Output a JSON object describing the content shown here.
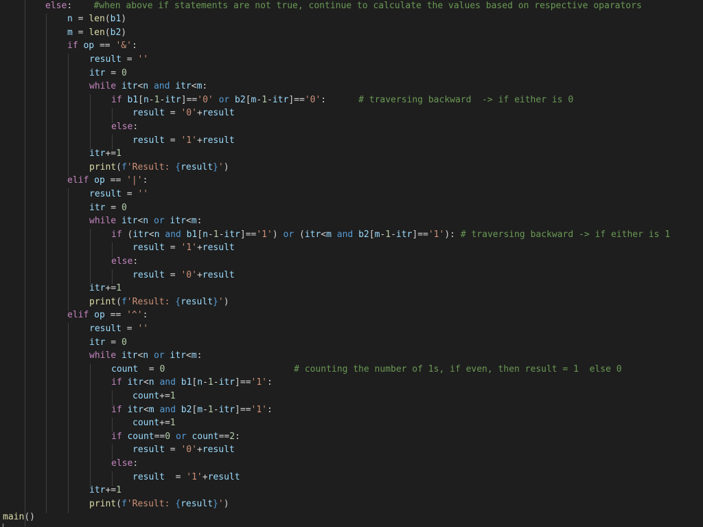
{
  "editor": {
    "language": "python",
    "colors": {
      "background": "#1e1e1e",
      "keyword": "#c586c0",
      "string": "#ce9178",
      "number": "#b5cea8",
      "variable": "#9cdcfe",
      "function": "#dcdcaa",
      "comment": "#6a9955",
      "plain": "#d4d4d4"
    },
    "lines": [
      [
        [
          "else",
          1
        ],
        [
          ":",
          0
        ],
        [
          "    ",
          0
        ],
        [
          "#when above if statements are not true, continue to calculate the values based on respective oparators",
          7
        ]
      ],
      [
        [
          "n",
          3
        ],
        [
          " = ",
          0
        ],
        [
          "len",
          5
        ],
        [
          "(",
          0
        ],
        [
          "b1",
          3
        ],
        [
          ")",
          0
        ]
      ],
      [
        [
          "m",
          3
        ],
        [
          " = ",
          0
        ],
        [
          "len",
          5
        ],
        [
          "(",
          0
        ],
        [
          "b2",
          3
        ],
        [
          ")",
          0
        ]
      ],
      [
        [
          "if",
          1
        ],
        [
          " ",
          0
        ],
        [
          "op",
          3
        ],
        [
          " == ",
          0
        ],
        [
          "'&'",
          2
        ],
        [
          ":",
          0
        ]
      ],
      [
        [
          "result",
          3
        ],
        [
          " = ",
          0
        ],
        [
          "''",
          2
        ]
      ],
      [
        [
          "itr",
          3
        ],
        [
          " = ",
          0
        ],
        [
          "0",
          4
        ]
      ],
      [
        [
          "while",
          1
        ],
        [
          " ",
          0
        ],
        [
          "itr",
          3
        ],
        [
          "<",
          0
        ],
        [
          "n",
          3
        ],
        [
          " ",
          0
        ],
        [
          "and",
          6
        ],
        [
          " ",
          0
        ],
        [
          "itr",
          3
        ],
        [
          "<",
          0
        ],
        [
          "m",
          3
        ],
        [
          ":",
          0
        ]
      ],
      [
        [
          "if",
          1
        ],
        [
          " ",
          0
        ],
        [
          "b1",
          3
        ],
        [
          "[",
          0
        ],
        [
          "n",
          3
        ],
        [
          "-",
          0
        ],
        [
          "1",
          4
        ],
        [
          "-",
          0
        ],
        [
          "itr",
          3
        ],
        [
          "]==",
          0
        ],
        [
          "'0'",
          2
        ],
        [
          " ",
          0
        ],
        [
          "or",
          6
        ],
        [
          " ",
          0
        ],
        [
          "b2",
          3
        ],
        [
          "[",
          0
        ],
        [
          "m",
          3
        ],
        [
          "-",
          0
        ],
        [
          "1",
          4
        ],
        [
          "-",
          0
        ],
        [
          "itr",
          3
        ],
        [
          "]==",
          0
        ],
        [
          "'0'",
          2
        ],
        [
          ":",
          0
        ],
        [
          "      ",
          0
        ],
        [
          "# traversing backward  -> if either is 0",
          7
        ]
      ],
      [
        [
          "result",
          3
        ],
        [
          " = ",
          0
        ],
        [
          "'0'",
          2
        ],
        [
          "+",
          0
        ],
        [
          "result",
          3
        ]
      ],
      [
        [
          "else",
          1
        ],
        [
          ":",
          0
        ]
      ],
      [
        [
          "result",
          3
        ],
        [
          " = ",
          0
        ],
        [
          "'1'",
          2
        ],
        [
          "+",
          0
        ],
        [
          "result",
          3
        ]
      ],
      [
        [
          "itr",
          3
        ],
        [
          "+=",
          0
        ],
        [
          "1",
          4
        ]
      ],
      [
        [
          "print",
          5
        ],
        [
          "(",
          0
        ],
        [
          "f",
          6
        ],
        [
          "'Result: ",
          2
        ],
        [
          "{",
          6
        ],
        [
          "result",
          3
        ],
        [
          "}",
          6
        ],
        [
          "'",
          2
        ],
        [
          ")",
          0
        ]
      ],
      [
        [
          "elif",
          1
        ],
        [
          " ",
          0
        ],
        [
          "op",
          3
        ],
        [
          " == ",
          0
        ],
        [
          "'|'",
          2
        ],
        [
          ":",
          0
        ]
      ],
      [
        [
          "result",
          3
        ],
        [
          " = ",
          0
        ],
        [
          "''",
          2
        ]
      ],
      [
        [
          "itr",
          3
        ],
        [
          " = ",
          0
        ],
        [
          "0",
          4
        ]
      ],
      [
        [
          "while",
          1
        ],
        [
          " ",
          0
        ],
        [
          "itr",
          3
        ],
        [
          "<",
          0
        ],
        [
          "n",
          3
        ],
        [
          " ",
          0
        ],
        [
          "or",
          6
        ],
        [
          " ",
          0
        ],
        [
          "itr",
          3
        ],
        [
          "<",
          0
        ],
        [
          "m",
          3
        ],
        [
          ":",
          0
        ]
      ],
      [
        [
          "if",
          1
        ],
        [
          " (",
          0
        ],
        [
          "itr",
          3
        ],
        [
          "<",
          0
        ],
        [
          "n",
          3
        ],
        [
          " ",
          0
        ],
        [
          "and",
          6
        ],
        [
          " ",
          0
        ],
        [
          "b1",
          3
        ],
        [
          "[",
          0
        ],
        [
          "n",
          3
        ],
        [
          "-",
          0
        ],
        [
          "1",
          4
        ],
        [
          "-",
          0
        ],
        [
          "itr",
          3
        ],
        [
          "]==",
          0
        ],
        [
          "'1'",
          2
        ],
        [
          ") ",
          0
        ],
        [
          "or",
          6
        ],
        [
          " (",
          0
        ],
        [
          "itr",
          3
        ],
        [
          "<",
          0
        ],
        [
          "m",
          3
        ],
        [
          " ",
          0
        ],
        [
          "and",
          6
        ],
        [
          " ",
          0
        ],
        [
          "b2",
          3
        ],
        [
          "[",
          0
        ],
        [
          "m",
          3
        ],
        [
          "-",
          0
        ],
        [
          "1",
          4
        ],
        [
          "-",
          0
        ],
        [
          "itr",
          3
        ],
        [
          "]==",
          0
        ],
        [
          "'1'",
          2
        ],
        [
          "): ",
          0
        ],
        [
          "# traversing backward -> if either is 1",
          7
        ]
      ],
      [
        [
          "result",
          3
        ],
        [
          " = ",
          0
        ],
        [
          "'1'",
          2
        ],
        [
          "+",
          0
        ],
        [
          "result",
          3
        ]
      ],
      [
        [
          "else",
          1
        ],
        [
          ":",
          0
        ]
      ],
      [
        [
          "result",
          3
        ],
        [
          " = ",
          0
        ],
        [
          "'0'",
          2
        ],
        [
          "+",
          0
        ],
        [
          "result",
          3
        ]
      ],
      [
        [
          "itr",
          3
        ],
        [
          "+=",
          0
        ],
        [
          "1",
          4
        ]
      ],
      [
        [
          "print",
          5
        ],
        [
          "(",
          0
        ],
        [
          "f",
          6
        ],
        [
          "'Result: ",
          2
        ],
        [
          "{",
          6
        ],
        [
          "result",
          3
        ],
        [
          "}",
          6
        ],
        [
          "'",
          2
        ],
        [
          ")",
          0
        ]
      ],
      [
        [
          "elif",
          1
        ],
        [
          " ",
          0
        ],
        [
          "op",
          3
        ],
        [
          " == ",
          0
        ],
        [
          "'^'",
          2
        ],
        [
          ":",
          0
        ]
      ],
      [
        [
          "result",
          3
        ],
        [
          " = ",
          0
        ],
        [
          "''",
          2
        ]
      ],
      [
        [
          "itr",
          3
        ],
        [
          " = ",
          0
        ],
        [
          "0",
          4
        ]
      ],
      [
        [
          "while",
          1
        ],
        [
          " ",
          0
        ],
        [
          "itr",
          3
        ],
        [
          "<",
          0
        ],
        [
          "n",
          3
        ],
        [
          " ",
          0
        ],
        [
          "or",
          6
        ],
        [
          " ",
          0
        ],
        [
          "itr",
          3
        ],
        [
          "<",
          0
        ],
        [
          "m",
          3
        ],
        [
          ":",
          0
        ]
      ],
      [
        [
          "count",
          3
        ],
        [
          "  = ",
          0
        ],
        [
          "0",
          4
        ],
        [
          "                        ",
          0
        ],
        [
          "# counting the number of 1s, if even, then result = 1  else 0",
          7
        ]
      ],
      [
        [
          "if",
          1
        ],
        [
          " ",
          0
        ],
        [
          "itr",
          3
        ],
        [
          "<",
          0
        ],
        [
          "n",
          3
        ],
        [
          " ",
          0
        ],
        [
          "and",
          6
        ],
        [
          " ",
          0
        ],
        [
          "b1",
          3
        ],
        [
          "[",
          0
        ],
        [
          "n",
          3
        ],
        [
          "-",
          0
        ],
        [
          "1",
          4
        ],
        [
          "-",
          0
        ],
        [
          "itr",
          3
        ],
        [
          "]==",
          0
        ],
        [
          "'1'",
          2
        ],
        [
          ":",
          0
        ]
      ],
      [
        [
          "count",
          3
        ],
        [
          "+=",
          0
        ],
        [
          "1",
          4
        ]
      ],
      [
        [
          "if",
          1
        ],
        [
          " ",
          0
        ],
        [
          "itr",
          3
        ],
        [
          "<",
          0
        ],
        [
          "m",
          3
        ],
        [
          " ",
          0
        ],
        [
          "and",
          6
        ],
        [
          " ",
          0
        ],
        [
          "b2",
          3
        ],
        [
          "[",
          0
        ],
        [
          "m",
          3
        ],
        [
          "-",
          0
        ],
        [
          "1",
          4
        ],
        [
          "-",
          0
        ],
        [
          "itr",
          3
        ],
        [
          "]==",
          0
        ],
        [
          "'1'",
          2
        ],
        [
          ":",
          0
        ]
      ],
      [
        [
          "count",
          3
        ],
        [
          "+=",
          0
        ],
        [
          "1",
          4
        ]
      ],
      [
        [
          "if",
          1
        ],
        [
          " ",
          0
        ],
        [
          "count",
          3
        ],
        [
          "==",
          0
        ],
        [
          "0",
          4
        ],
        [
          " ",
          0
        ],
        [
          "or",
          6
        ],
        [
          " ",
          0
        ],
        [
          "count",
          3
        ],
        [
          "==",
          0
        ],
        [
          "2",
          4
        ],
        [
          ":",
          0
        ]
      ],
      [
        [
          "result",
          3
        ],
        [
          " = ",
          0
        ],
        [
          "'0'",
          2
        ],
        [
          "+",
          0
        ],
        [
          "result",
          3
        ]
      ],
      [
        [
          "else",
          1
        ],
        [
          ":",
          0
        ]
      ],
      [
        [
          "result",
          3
        ],
        [
          "  = ",
          0
        ],
        [
          "'1'",
          2
        ],
        [
          "+",
          0
        ],
        [
          "result",
          3
        ]
      ],
      [
        [
          "itr",
          3
        ],
        [
          "+=",
          0
        ],
        [
          "1",
          4
        ]
      ],
      [
        [
          "print",
          5
        ],
        [
          "(",
          0
        ],
        [
          "f",
          6
        ],
        [
          "'Result: ",
          2
        ],
        [
          "{",
          6
        ],
        [
          "result",
          3
        ],
        [
          "}",
          6
        ],
        [
          "'",
          2
        ],
        [
          ")",
          0
        ]
      ],
      [
        [
          "main",
          5
        ],
        [
          "()",
          0
        ]
      ]
    ]
  }
}
